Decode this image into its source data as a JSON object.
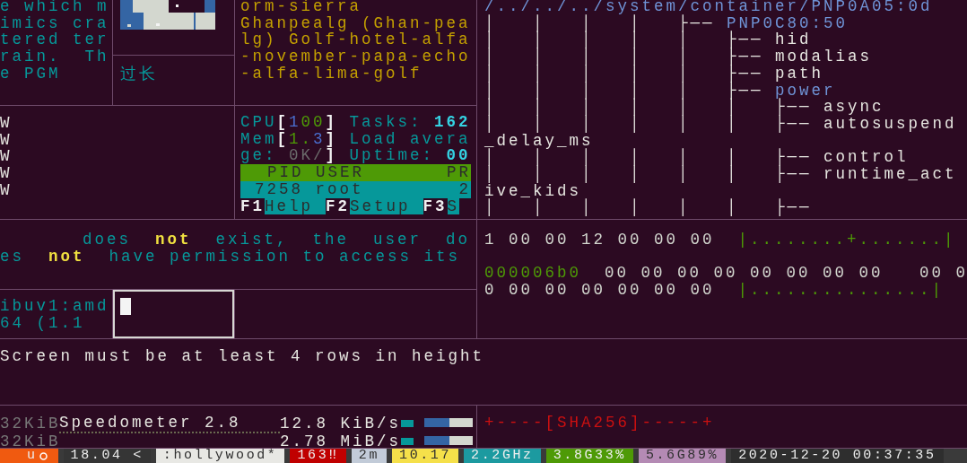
{
  "panes": {
    "notes": {
      "lines": [
        "e which m",
        "imics cra",
        "tered ter",
        "rain.  Th",
        "e PGM"
      ]
    },
    "label": {
      "text": "过长"
    },
    "callsign": {
      "lines": [
        "orm-sierra",
        "Ghanpealg (Ghan-pea",
        "lg) Golf-hotel-alfa",
        "-november-papa-echo",
        "-alfa-lima-golf"
      ]
    },
    "tree": {
      "path": "/../../../system/container/PNP0A05:0d",
      "rows": [
        {
          "prefix": "│   │   │   │   ├── ",
          "name": "PNP0C80:50",
          "kind": "dir"
        },
        {
          "prefix": "│   │   │   │   │   ├── ",
          "name": "hid",
          "kind": "file"
        },
        {
          "prefix": "│   │   │   │   │   ├── ",
          "name": "modalias",
          "kind": "file"
        },
        {
          "prefix": "│   │   │   │   │   ├── ",
          "name": "path",
          "kind": "file"
        },
        {
          "prefix": "│   │   │   │   │   ├── ",
          "name": "power",
          "kind": "dir"
        },
        {
          "prefix": "│   │   │   │   │   │   ├── ",
          "name": "async",
          "kind": "file"
        },
        {
          "prefix": "│   │   │   │   │   │   ├── ",
          "name": "autosuspend",
          "kind": "file"
        },
        {
          "prefix": "",
          "name": "_delay_ms",
          "kind": "file"
        },
        {
          "prefix": "│   │   │   │   │   │   ├── ",
          "name": "control",
          "kind": "file"
        },
        {
          "prefix": "│   │   │   │   │   │   ├── ",
          "name": "runtime_act",
          "kind": "file"
        },
        {
          "prefix": "",
          "name": "ive_kids",
          "kind": "file"
        },
        {
          "prefix": "│   │   │   │   │   │   ├──"
        }
      ]
    },
    "warnings": {
      "lines": [
        "W",
        "W",
        "W",
        "W",
        "W"
      ]
    },
    "htop": {
      "meters": [
        [
          {
            "text": "CPU",
            "kind": "label"
          },
          {
            "text": "[",
            "kind": "bracket"
          },
          {
            "text": "1",
            "kind": "blue"
          },
          {
            "text": "00",
            "kind": "value"
          },
          {
            "text": "]",
            "kind": "bracket"
          },
          {
            "text": " Tasks: ",
            "kind": "label"
          },
          {
            "text": "162",
            "kind": "accent"
          }
        ],
        [
          {
            "text": "Mem",
            "kind": "label"
          },
          {
            "text": "[",
            "kind": "bracket"
          },
          {
            "text": "1.",
            "kind": "value"
          },
          {
            "text": "3",
            "kind": "blue"
          },
          {
            "text": "]",
            "kind": "bracket"
          },
          {
            "text": " Load avera",
            "kind": "label"
          }
        ],
        [
          {
            "text": "ge: ",
            "kind": "label"
          },
          {
            "text": "0K/",
            "kind": "muted"
          },
          {
            "text": "]",
            "kind": "bracket"
          },
          {
            "text": " Uptime: ",
            "kind": "label"
          },
          {
            "text": "00",
            "kind": "accent"
          }
        ]
      ],
      "columns": [
        "PID USER",
        "PR"
      ],
      "process": {
        "pid": "7258",
        "user": "root",
        "priority": "2",
        "selected": true
      },
      "keys": [
        {
          "key": "F1",
          "label": "Help"
        },
        {
          "key": "F2",
          "label": "Setup"
        },
        {
          "key": "F3",
          "label": "S"
        }
      ]
    },
    "error": {
      "lines": [
        "does  **not**  exist,  the  user  do",
        "es  **not**  have permission to access its"
      ]
    },
    "package": {
      "lines": [
        "ibuv1:amd",
        "64 (1.1"
      ]
    },
    "prompt": {
      "cursor": true
    },
    "hexdump": {
      "rows": [
        [
          {
            "text": "1 00 00 12 00 00 00",
            "kind": "hex"
          },
          {
            "text": "|........+.......|",
            "kind": "ascii"
          }
        ],
        [],
        [
          {
            "text": "000006b0",
            "kind": "offset"
          },
          {
            "text": "00 00 00 00 00 00 00 00   00 0",
            "kind": "hex"
          }
        ],
        [
          {
            "text": "0 00 00 00 00 00 00",
            "kind": "hex"
          },
          {
            "text": "|...............|",
            "kind": "ascii"
          }
        ]
      ]
    },
    "message": {
      "text": "Screen must be at least 4 rows in height"
    },
    "speed": {
      "rows": [
        {
          "scale": "32KiB",
          "title": "Speedometer 2.8",
          "reading": "12.8 KiB/s"
        },
        {
          "scale": "32KiB",
          "reading": "2.78 MiB/s"
        }
      ]
    },
    "fingerprint": {
      "text": "+----[SHA256]-----+"
    }
  },
  "status_bar": [
    {
      "text": "u",
      "kind": "os",
      "color": "#f05a10"
    },
    {
      "text": "18.04 <",
      "kind": "text",
      "color": "#353535"
    },
    {
      "text": ":hollywood*",
      "kind": "text",
      "color": "#e8e8e4"
    },
    {
      "text": "163‼",
      "kind": "text",
      "color": "#c00000"
    },
    {
      "text": "2m",
      "kind": "text",
      "color": "#c2cbd8"
    },
    {
      "text": "10.17",
      "kind": "text",
      "color": "#f5e04a"
    },
    {
      "text": "2.2GHz",
      "kind": "text",
      "color": "#1c9aa0"
    },
    {
      "text": "3.8G33%",
      "kind": "text",
      "color": "#4e9a06"
    },
    {
      "text": "5.6G89%",
      "kind": "text",
      "color": "#b48ab4"
    },
    {
      "text": "2020-12-20 00:37:35",
      "kind": "text",
      "color": "#2e2e2e"
    }
  ]
}
